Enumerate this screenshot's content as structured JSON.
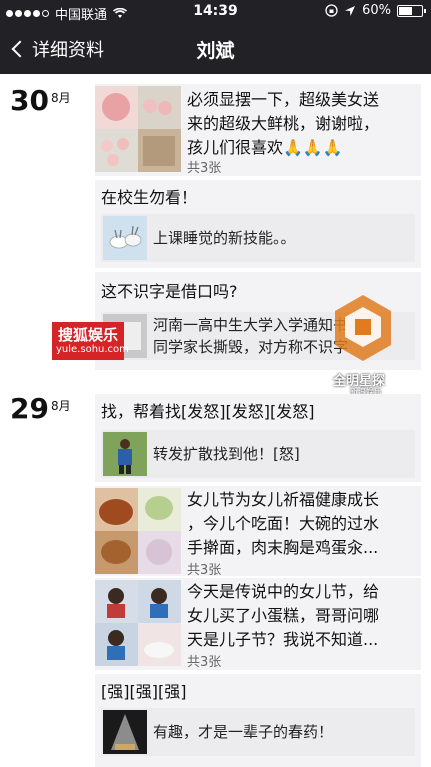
{
  "status_bar": {
    "carrier": "中国联通",
    "time": "14:39",
    "battery": "60%",
    "battery_level": 0.6
  },
  "nav": {
    "back_label": "详细资料",
    "title": "刘斌"
  },
  "days": [
    {
      "day": "30",
      "month": "8月"
    },
    {
      "day": "29",
      "month": "8月"
    }
  ],
  "posts": {
    "peach": {
      "text_lines": [
        "必须显摆一下，超级美女送",
        "来的超级大鲜桃，谢谢啦，",
        "孩儿们很喜欢🙏🙏🙏"
      ],
      "count": "共3张"
    },
    "school": {
      "text": "在校生勿看！",
      "share_text": "上课睡觉的新技能。。"
    },
    "literacy": {
      "text": "这不识字是借口吗?",
      "share_text": "河南一高中生大学入学通知书被",
      "share_text2": "同学家长撕毁，对方称不识字"
    },
    "find": {
      "text": "找，帮着找[发怒][发怒][发怒]",
      "share_text": "转发扩散找到他！[怒]"
    },
    "daughter1": {
      "text_lines": [
        "女儿节为女儿祈福健康成长",
        "，今儿个吃面！大碗的过水",
        "手擀面，肉末胸是鸡蛋汆..."
      ],
      "count": "共3张"
    },
    "daughter2": {
      "text_lines": [
        "今天是传说中的女儿节，给",
        "女儿买了小蛋糕，哥哥问哪",
        "天是儿子节？我说不知道..."
      ],
      "count": "共3张"
    },
    "strong": {
      "text": "[强][强][强]",
      "share_text": "有趣，才是一辈子的春药！"
    }
  },
  "watermarks": {
    "sohu_main": "搜狐娱乐",
    "sohu_url": "yule.sohu.com",
    "brand": "全明星探",
    "brand_sub": "新浪娱乐"
  }
}
